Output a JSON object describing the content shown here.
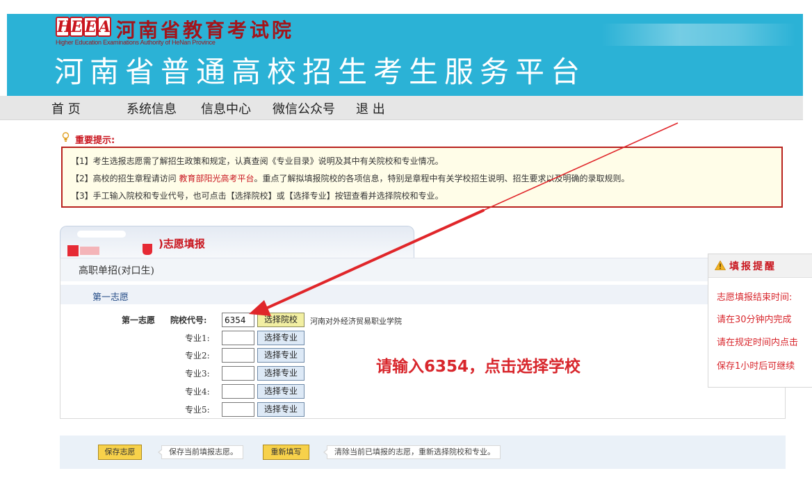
{
  "header": {
    "logo_letters": [
      "H",
      "E",
      "E",
      "A"
    ],
    "org_cn": "河南省教育考试院",
    "org_en": "Higher Education Examinations Authority of HeNan Province",
    "platform_title": "河南省普通高校招生考生服务平台"
  },
  "nav": {
    "items": [
      "首  页",
      "系统信息",
      "信息中心",
      "微信公众号",
      "退  出"
    ]
  },
  "notice": {
    "title": "重要提示:",
    "line1": "【1】考生选报志愿需了解招生政策和规定，认真查阅《专业目录》说明及其中有关院校和专业情况。",
    "line2_pre": "【2】高校的招生章程请访问 ",
    "line2_link": "教育部阳光高考平台",
    "line2_post": "。重点了解拟填报院校的各项信息，特别是章程中有关学校招生说明、招生要求以及明确的录取规则。",
    "line3": "【3】手工输入院校和专业代号，也可点击【选择院校】或【选择专业】按钮查看并选择院校和专业。"
  },
  "form": {
    "title": ")志愿填报",
    "category": "高职单招(对口生)",
    "section": "第一志愿",
    "choice_label": "第一志愿",
    "school_code_label": "院校代号:",
    "school_code_value": "6354",
    "select_school_label": "选择院校",
    "school_name": "河南对外经济贸易职业学院",
    "majors": [
      {
        "label": "专业1:",
        "value": "",
        "button": "选择专业"
      },
      {
        "label": "专业2:",
        "value": "",
        "button": "选择专业"
      },
      {
        "label": "专业3:",
        "value": "",
        "button": "选择专业"
      },
      {
        "label": "专业4:",
        "value": "",
        "button": "选择专业"
      },
      {
        "label": "专业5:",
        "value": "",
        "button": "选择专业"
      }
    ]
  },
  "annotation": "请输入6354，点击选择学校",
  "reminder": {
    "title": "填报提醒",
    "lines": [
      "志愿填报结束时间:",
      "请在30分钟内完成",
      "请在规定时间内点击",
      "保存1小时后可继续"
    ]
  },
  "bottom": {
    "save_label": "保存志愿",
    "save_tip": "保存当前填报志愿。",
    "reset_label": "重新填写",
    "reset_tip": "清除当前已填报的志愿，重新选择院校和专业。"
  },
  "colors": {
    "header_bg": "#2bb2d6",
    "accent_red": "#c9151e",
    "annotation_red": "#d8262c"
  }
}
